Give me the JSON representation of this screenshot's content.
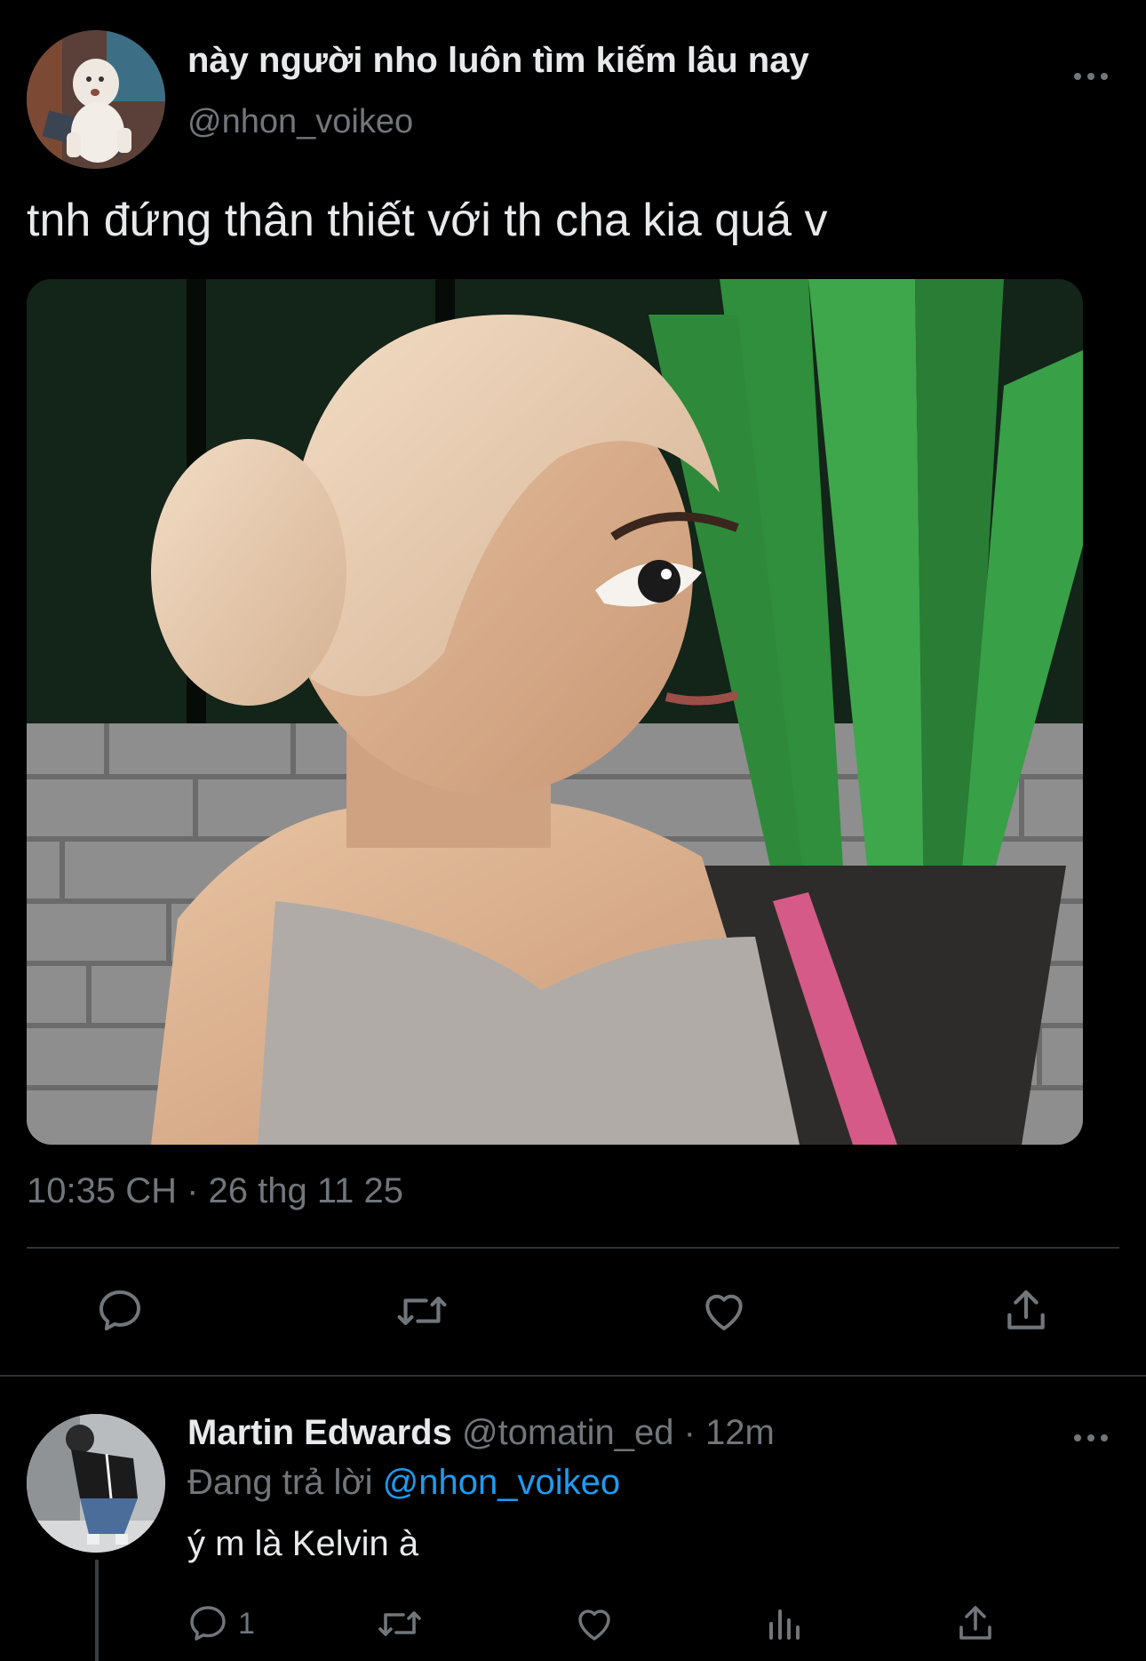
{
  "tweet": {
    "author_name": "này người nho luôn tìm kiếm lâu nay",
    "author_handle": "@nhon_voikeo",
    "text": "tnh đứng thân thiết với th cha kia quá v",
    "timestamp": "10:35 CH · 26 thg 11 25",
    "media_icon": "photo",
    "actions": [
      {
        "icon": "reply-icon"
      },
      {
        "icon": "retweet-icon"
      },
      {
        "icon": "like-icon"
      },
      {
        "icon": "share-icon"
      }
    ]
  },
  "reply": {
    "author_name": "Martin Edwards",
    "author_handle": "@tomatin_ed",
    "separator": "·",
    "time": "12m",
    "replying_prefix": "Đang trả lời",
    "replying_to": "@nhon_voikeo",
    "text": "ý m là Kelvin à",
    "reply_count": "1",
    "actions": [
      {
        "icon": "reply-icon"
      },
      {
        "icon": "retweet-icon"
      },
      {
        "icon": "like-icon"
      },
      {
        "icon": "views-icon"
      },
      {
        "icon": "share-icon"
      }
    ]
  },
  "colors": {
    "background": "#000000",
    "primary_text": "#e7e9ea",
    "secondary_text": "#71767b",
    "link": "#1d9bf0",
    "divider": "#2f3336"
  }
}
